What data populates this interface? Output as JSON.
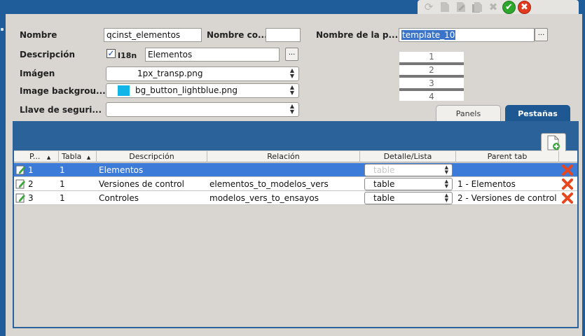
{
  "form": {
    "nombre_label": "Nombre",
    "nombre_value": "qcinst_elementos",
    "nombre_corto_label": "Nombre co...",
    "nombre_corto_value": "",
    "nombre_plantilla_label": "Nombre de la p...",
    "nombre_plantilla_value": "template_10",
    "descripcion_label": "Descripción",
    "i18n_label": "I18n",
    "i18n_checked": "✓",
    "descripcion_value": "Elementos",
    "imagen_label": "Imágen",
    "imagen_value": "1px_transp.png",
    "image_bg_label": "Image backgrou...",
    "image_bg_value": "bg_button_lightblue.png",
    "image_bg_color": "#12b5e8",
    "llave_label": "Llave de seguri...",
    "llave_value": "",
    "dots": "..."
  },
  "preview": {
    "numbers": [
      "1",
      "2",
      "3",
      "4"
    ]
  },
  "tabs": {
    "panels": "Panels",
    "pestanas": "Pestañas"
  },
  "toolbar": {
    "icons": [
      "refresh-icon",
      "new-document-icon",
      "edit-document-icon",
      "copy-document-icon",
      "delete-x-icon",
      "accept-check-icon",
      "cancel-x-icon"
    ]
  },
  "grid": {
    "headers": [
      "P...",
      "Tabla",
      "Descripción",
      "Relación",
      "Detalle/Lista",
      "Parent tab"
    ],
    "sort_arrow": "▲",
    "rows": [
      {
        "p": "1",
        "tabla": "1",
        "descripcion": "Elementos",
        "relacion": "",
        "detalle": "table",
        "parent": ""
      },
      {
        "p": "2",
        "tabla": "1",
        "descripcion": "Versiones de control",
        "relacion": "elementos_to_modelos_vers",
        "detalle": "table",
        "parent": "1 - Elementos"
      },
      {
        "p": "3",
        "tabla": "1",
        "descripcion": "Controles",
        "relacion": "modelos_vers_to_ensayos",
        "detalle": "table",
        "parent": "2 - Versiones de control"
      }
    ]
  },
  "colors": {
    "frame_blue": "#1f5d9a",
    "selected_row": "#3d7bd8",
    "accept_green": "#2ea62e",
    "cancel_red": "#e23a1e"
  }
}
